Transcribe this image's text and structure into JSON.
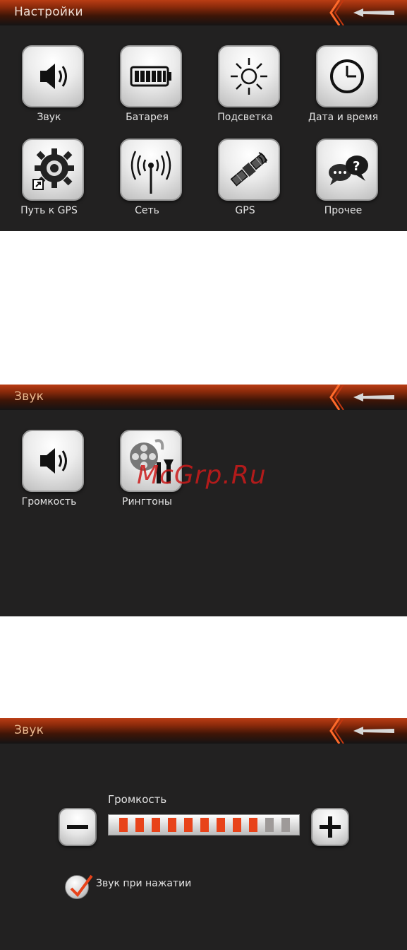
{
  "screen_settings": {
    "title": "Настройки",
    "items": [
      {
        "label": "Звук",
        "icon": "speaker-icon"
      },
      {
        "label": "Батарея",
        "icon": "battery-icon"
      },
      {
        "label": "Подсветка",
        "icon": "sun-icon"
      },
      {
        "label": "Дата и время",
        "icon": "clock-icon"
      },
      {
        "label": "Путь к GPS",
        "icon": "gear-shortcut-icon"
      },
      {
        "label": "Сеть",
        "icon": "antenna-icon"
      },
      {
        "label": "GPS",
        "icon": "satellite-icon"
      },
      {
        "label": "Прочее",
        "icon": "chat-question-icon"
      }
    ]
  },
  "screen_sound": {
    "title": "Звук",
    "items": [
      {
        "label": "Громкость",
        "icon": "speaker-icon"
      },
      {
        "label": "Рингтоны",
        "icon": "film-reel-tools-icon"
      }
    ],
    "watermark": "McGrp.Ru"
  },
  "screen_volume": {
    "title": "Звук",
    "volume_label": "Громкость",
    "volume_level": 9,
    "volume_max": 11,
    "click_sound_label": "Звук при нажатии",
    "click_sound_checked": true
  },
  "colors": {
    "header_accent": "#ba3d14",
    "screen_bg": "#222121",
    "volume_on": "#e8431a",
    "volume_off": "#9e9a99",
    "checkmark": "#e8431a"
  }
}
